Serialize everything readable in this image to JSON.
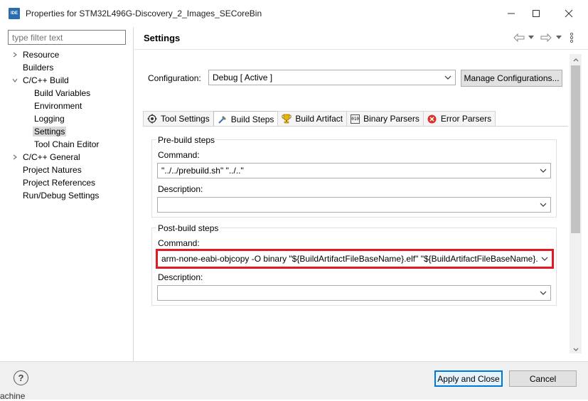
{
  "window": {
    "app_icon_text": "IDE",
    "title": "Properties for STM32L496G-Discovery_2_Images_SECoreBin"
  },
  "filter": {
    "placeholder": "type filter text"
  },
  "tree": {
    "resource": "Resource",
    "builders": "Builders",
    "cc_build": "C/C++ Build",
    "build_variables": "Build Variables",
    "environment": "Environment",
    "logging": "Logging",
    "settings": "Settings",
    "tool_chain_editor": "Tool Chain Editor",
    "cc_general": "C/C++ General",
    "project_natures": "Project Natures",
    "project_references": "Project References",
    "run_debug_settings": "Run/Debug Settings"
  },
  "page": {
    "title": "Settings"
  },
  "configuration": {
    "label": "Configuration:",
    "value": "Debug  [ Active ]",
    "manage_label": "Manage Configurations..."
  },
  "tabs": {
    "tool_settings": "Tool Settings",
    "build_steps": "Build Steps",
    "build_artifact": "Build Artifact",
    "binary_parsers": "Binary Parsers",
    "error_parsers": "Error Parsers",
    "binary_icon_text": "010"
  },
  "pre_build": {
    "title": "Pre-build steps",
    "command_label": "Command:",
    "command_value": "\"../../prebuild.sh\" \"../..\"",
    "description_label": "Description:",
    "description_value": ""
  },
  "post_build": {
    "title": "Post-build steps",
    "command_label": "Command:",
    "command_value": "arm-none-eabi-objcopy -O binary \"${BuildArtifactFileBaseName}.elf\" \"${BuildArtifactFileBaseName}.",
    "description_label": "Description:",
    "description_value": ""
  },
  "footer": {
    "help_icon_text": "?",
    "apply_close_label": "Apply and Close",
    "cancel_label": "Cancel"
  },
  "behind_text": "achine",
  "colors": {
    "highlight": "#e01b24",
    "default_button_border": "#0078d7",
    "selection": "#d9d9d9"
  }
}
